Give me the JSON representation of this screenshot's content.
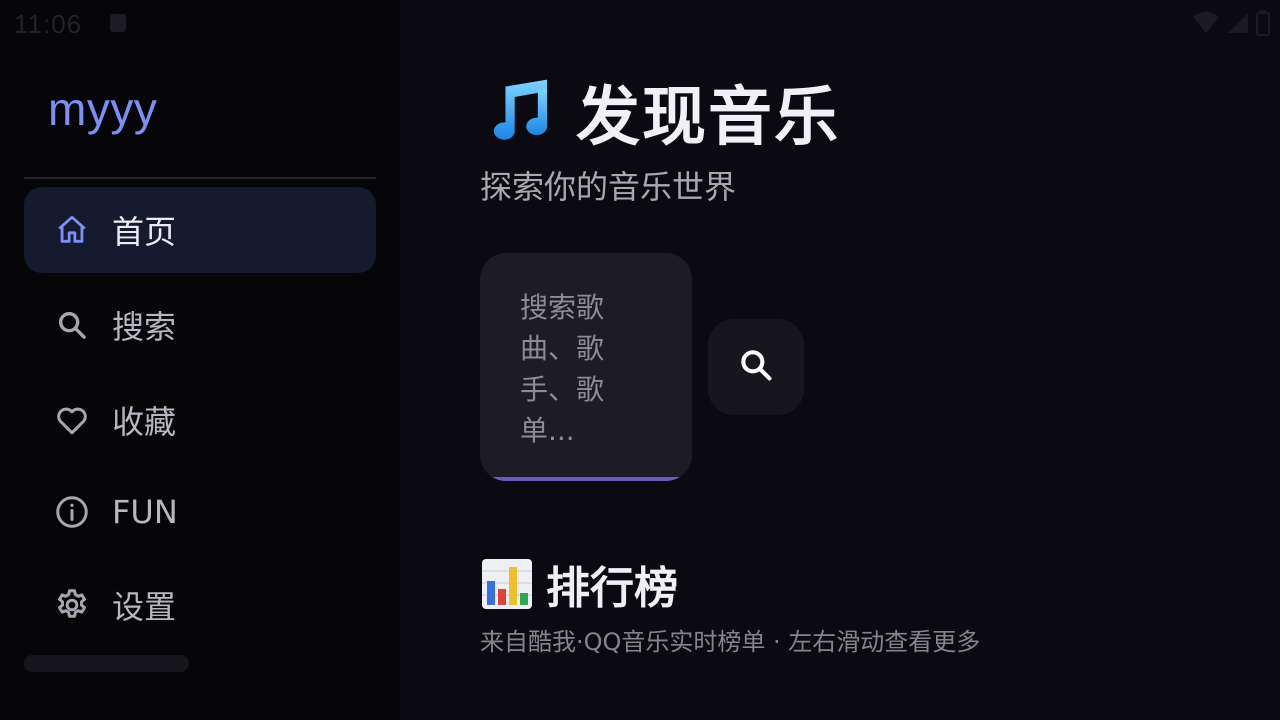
{
  "status_bar": {
    "time": "11:06"
  },
  "sidebar": {
    "logo": "myyy",
    "items": [
      {
        "label": "首页",
        "icon": "home-icon",
        "active": true
      },
      {
        "label": "搜索",
        "icon": "search-icon",
        "active": false
      },
      {
        "label": "收藏",
        "icon": "heart-icon",
        "active": false
      },
      {
        "label": "FUN",
        "icon": "info-icon",
        "active": false
      },
      {
        "label": "设置",
        "icon": "gear-icon",
        "active": false
      }
    ]
  },
  "main": {
    "title_icon": "music-note-icon",
    "title": "发现音乐",
    "subtitle": "探索你的音乐世界",
    "search": {
      "placeholder": "搜索歌曲、歌手、歌单..."
    },
    "section": {
      "icon": "bar-chart-icon",
      "title": "排行榜",
      "subtitle": "来自酷我·QQ音乐实时榜单 · 左右滑动查看更多"
    }
  },
  "colors": {
    "accent": "#7b8ff5",
    "active_nav_bg": "#161a2e",
    "input_underline": "#6e5ab8",
    "background": "#0b0a10",
    "sidebar_bg": "#060609"
  }
}
